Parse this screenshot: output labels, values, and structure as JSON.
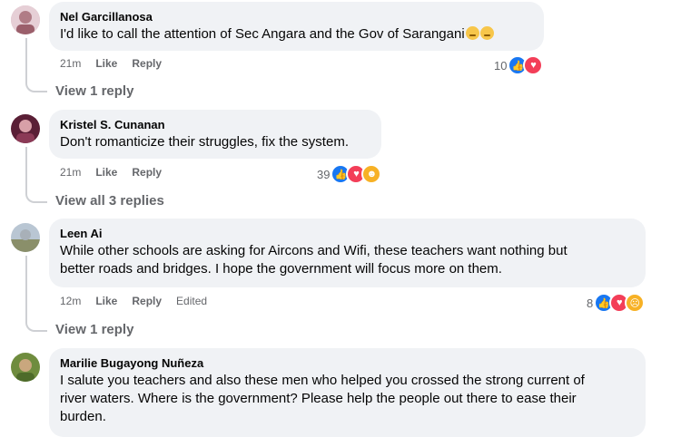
{
  "comments": [
    {
      "name": "Nel Garcillanosa",
      "text": "I'd like to call the attention of Sec Angara and the Gov of Sarangani",
      "time": "21m",
      "like": "Like",
      "reply": "Reply",
      "reaction_count": "10",
      "reactions": [
        "like-icon",
        "love-icon"
      ],
      "view_replies": "View 1 reply",
      "avatar_color": "#c9a8b4"
    },
    {
      "name": "Kristel S. Cunanan",
      "text": "Don't romanticize their struggles, fix the system.",
      "time": "21m",
      "like": "Like",
      "reply": "Reply",
      "reaction_count": "39",
      "reactions": [
        "like-icon",
        "love-icon",
        "care-icon"
      ],
      "view_replies": "View all 3 replies",
      "avatar_color": "#7a2a46"
    },
    {
      "name": "Leen Ai",
      "text_line1": "While other schools are asking for Aircons and Wifi, these teachers want nothing but",
      "text_line2": "better roads and bridges. I hope the government will focus more on them.",
      "time": "12m",
      "like": "Like",
      "reply": "Reply",
      "edited": "Edited",
      "reaction_count": "8",
      "reactions": [
        "like-icon",
        "love-icon",
        "sad-icon"
      ],
      "view_replies": "View 1 reply",
      "avatar_color": "#8fa3b8"
    },
    {
      "name": "Marilie Bugayong Nuñeza",
      "text_line1": "I salute you teachers and also these men who helped you crossed the strong current of",
      "text_line2": "river waters. Where is the government? Please help the people out there to ease their",
      "text_line3": "burden.",
      "avatar_color": "#7f9a4a"
    }
  ]
}
